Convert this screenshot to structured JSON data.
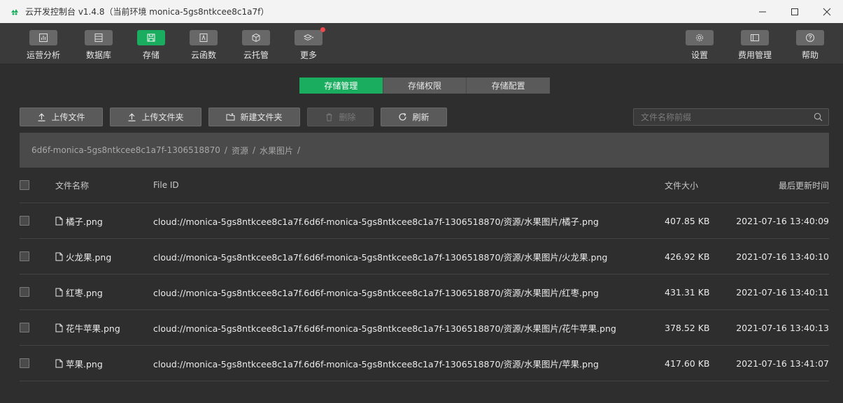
{
  "window": {
    "title": "云开发控制台 v1.4.8（当前环境 monica-5gs8ntkcee8c1a7f）",
    "controls": [
      "minimize",
      "maximize",
      "close"
    ]
  },
  "toolbar": {
    "left": [
      {
        "label": "运营分析",
        "icon": "chart-icon",
        "active": false
      },
      {
        "label": "数据库",
        "icon": "database-icon",
        "active": false
      },
      {
        "label": "存储",
        "icon": "storage-icon",
        "active": true
      },
      {
        "label": "云函数",
        "icon": "function-icon",
        "active": false
      },
      {
        "label": "云托管",
        "icon": "cube-icon",
        "active": false
      },
      {
        "label": "更多",
        "icon": "layers-icon",
        "active": false,
        "badge": true
      }
    ],
    "right": [
      {
        "label": "设置",
        "icon": "gear-icon"
      },
      {
        "label": "费用管理",
        "icon": "billing-icon"
      },
      {
        "label": "帮助",
        "icon": "help-icon"
      }
    ]
  },
  "tabs": [
    {
      "label": "存储管理",
      "active": true
    },
    {
      "label": "存储权限",
      "active": false
    },
    {
      "label": "存储配置",
      "active": false
    }
  ],
  "actions": {
    "upload_file": "上传文件",
    "upload_folder": "上传文件夹",
    "new_folder": "新建文件夹",
    "delete": "删除",
    "refresh": "刷新"
  },
  "search": {
    "placeholder": "文件名称前缀",
    "value": ""
  },
  "breadcrumb": [
    "6d6f-monica-5gs8ntkcee8c1a7f-1306518870",
    "资源",
    "水果图片"
  ],
  "table": {
    "columns": {
      "name": "文件名称",
      "id": "File ID",
      "size": "文件大小",
      "time": "最后更新时间"
    },
    "rows": [
      {
        "name": "橘子.png",
        "id": "cloud://monica-5gs8ntkcee8c1a7f.6d6f-monica-5gs8ntkcee8c1a7f-1306518870/资源/水果图片/橘子.png",
        "size": "407.85 KB",
        "time": "2021-07-16 13:40:09"
      },
      {
        "name": "火龙果.png",
        "id": "cloud://monica-5gs8ntkcee8c1a7f.6d6f-monica-5gs8ntkcee8c1a7f-1306518870/资源/水果图片/火龙果.png",
        "size": "426.92 KB",
        "time": "2021-07-16 13:40:10"
      },
      {
        "name": "红枣.png",
        "id": "cloud://monica-5gs8ntkcee8c1a7f.6d6f-monica-5gs8ntkcee8c1a7f-1306518870/资源/水果图片/红枣.png",
        "size": "431.31 KB",
        "time": "2021-07-16 13:40:11"
      },
      {
        "name": "花牛苹果.png",
        "id": "cloud://monica-5gs8ntkcee8c1a7f.6d6f-monica-5gs8ntkcee8c1a7f-1306518870/资源/水果图片/花牛苹果.png",
        "size": "378.52 KB",
        "time": "2021-07-16 13:40:13"
      },
      {
        "name": "苹果.png",
        "id": "cloud://monica-5gs8ntkcee8c1a7f.6d6f-monica-5gs8ntkcee8c1a7f-1306518870/资源/水果图片/苹果.png",
        "size": "417.60 KB",
        "time": "2021-07-16 13:41:07"
      }
    ]
  },
  "colors": {
    "accent": "#1aad5f",
    "badge": "#f0474b",
    "background": "#2e2e2e"
  }
}
